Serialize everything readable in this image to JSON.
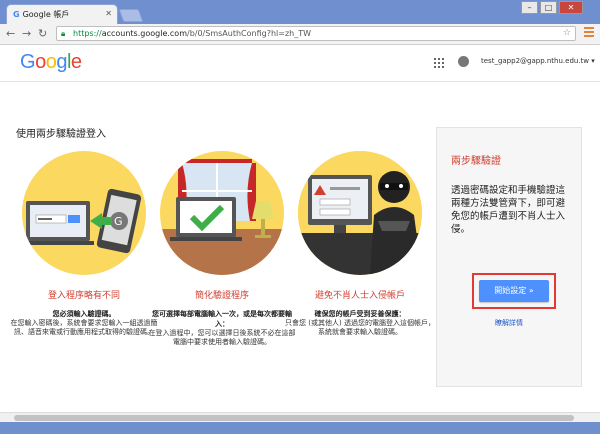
{
  "browser": {
    "tab_title": "Google 帳戶",
    "tab_favicon": "G",
    "tab_close": "✕",
    "window_min": "–",
    "window_max": "□",
    "window_close": "✕",
    "url_scheme": "https://",
    "url_host": "accounts.google.com",
    "url_path": "/b/0/SmsAuthConfig?hl=zh_TW",
    "back": "←",
    "forward": "→",
    "reload": "↻"
  },
  "header": {
    "logo_letters": [
      {
        "ch": "G",
        "color": "#4285f4"
      },
      {
        "ch": "o",
        "color": "#ea4335"
      },
      {
        "ch": "o",
        "color": "#fbbc05"
      },
      {
        "ch": "g",
        "color": "#4285f4"
      },
      {
        "ch": "l",
        "color": "#34a853"
      },
      {
        "ch": "e",
        "color": "#ea4335"
      }
    ],
    "account_email": "test_gapp2@gapp.nthu.edu.tw ▾"
  },
  "main": {
    "title": "使用兩步驟驗證登入",
    "steps": [
      {
        "caption": "登入程序略有不同",
        "bold": "您必須輸入驗證碼。",
        "text": "在您輸入密碼後，系統會要求您輸入一組透過簡訊、語音來電或行動應用程式取得的驗證碼。"
      },
      {
        "caption": "簡化驗證程序",
        "bold": "您可選擇每部電腦輸入一次，或是每次都要輸入：",
        "text": "在登入過程中，您可以選擇日後系統不必在這部電腦中要求使用者輸入驗證碼。"
      },
      {
        "caption": "避免不肖人士入侵帳戶",
        "bold": "確保您的帳戶受到妥善保護：",
        "text": "只會您 (或其他人) 透過您的電腦登入這個帳戶，系統就會要求輸入驗證碼。"
      }
    ]
  },
  "sidebar": {
    "heading": "兩步驟驗證",
    "description": "透過密碼設定和手機驗證這兩種方法雙管齊下，即可避免您的帳戶遭到不肖人士入侵。",
    "start_button": "開始設定 »",
    "learn_more": "瞭解詳情"
  }
}
